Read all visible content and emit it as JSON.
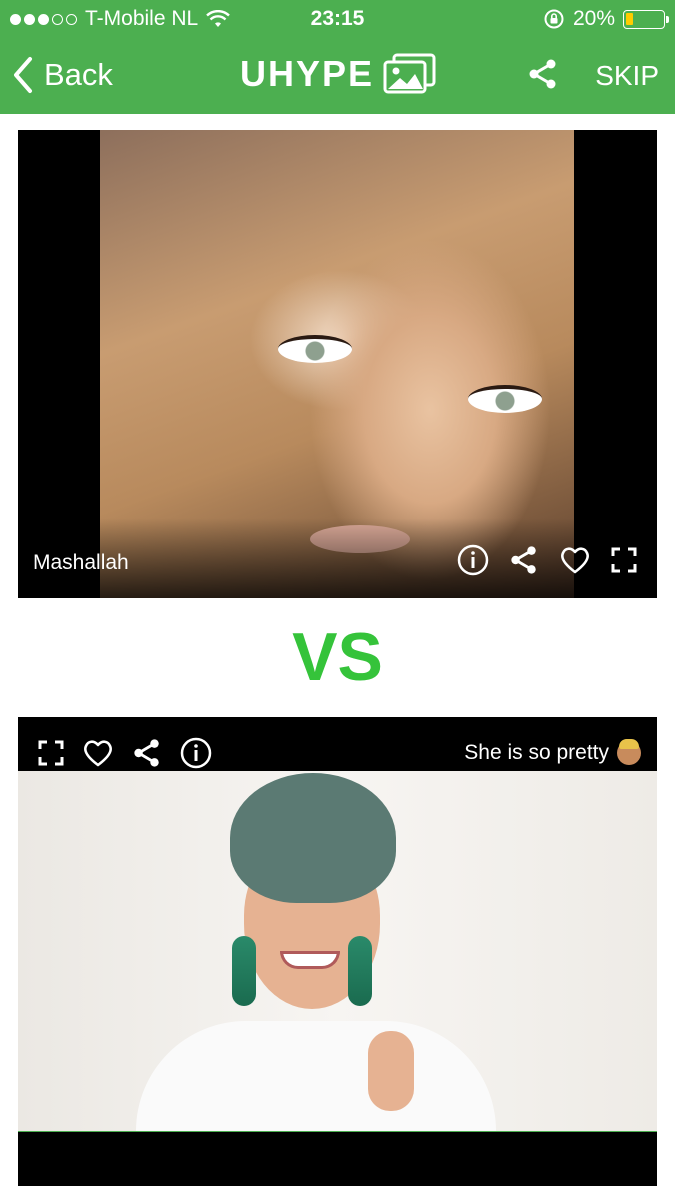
{
  "status_bar": {
    "carrier": "T-Mobile NL",
    "time": "23:15",
    "battery_percent": "20%",
    "battery_level": 0.2,
    "battery_color": "#ffcc00"
  },
  "nav": {
    "back_label": "Back",
    "logo_text": "UHYPE",
    "skip_label": "SKIP"
  },
  "colors": {
    "header_bg": "#4caf50",
    "vs_color": "#35c33a"
  },
  "cards": [
    {
      "caption": "Mashallah",
      "icons": [
        "info-icon",
        "share-icon",
        "heart-icon",
        "fullscreen-icon"
      ]
    },
    {
      "caption": "She is so pretty",
      "icons": [
        "fullscreen-icon",
        "heart-icon",
        "share-icon",
        "info-icon"
      ]
    }
  ],
  "vs_label": "VS"
}
